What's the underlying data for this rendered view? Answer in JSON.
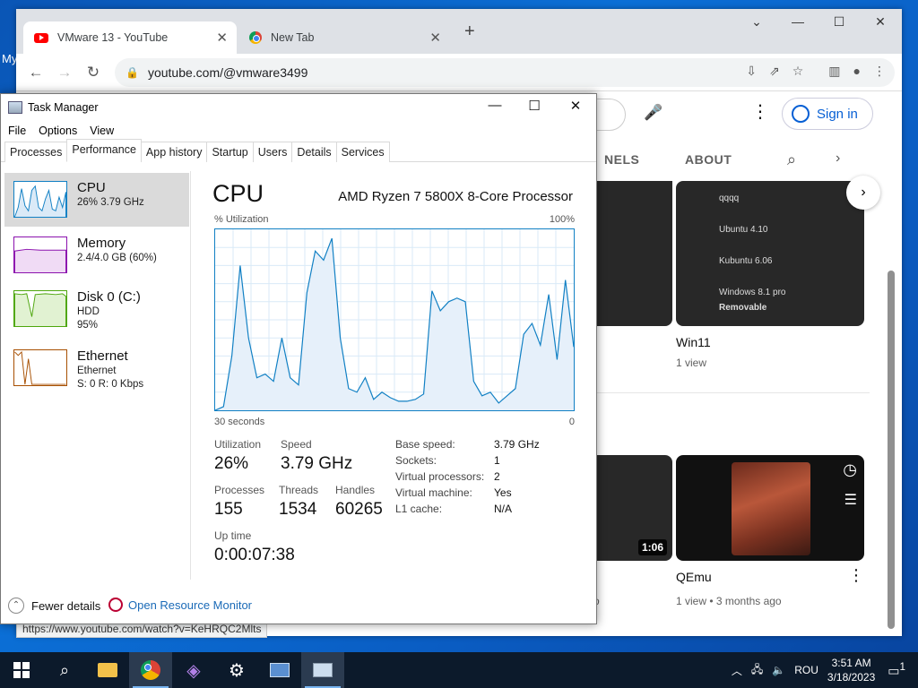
{
  "desktop": {
    "label": "My"
  },
  "browser": {
    "tabs": [
      {
        "label": "VMware 13 - YouTube"
      },
      {
        "label": "New Tab"
      }
    ],
    "url": "youtube.com/@vmware3499",
    "status_url": "https://www.youtube.com/watch?v=KeHRQC2Mlts"
  },
  "youtube": {
    "signin": "Sign in",
    "channel_tabs": [
      "NELS",
      "ABOUT"
    ],
    "videos": [
      {
        "title": "Win11",
        "meta": "1 view"
      },
      {
        "title": "QEmu",
        "meta": "1 view • 3 months ago",
        "duration": "1:06",
        "left_meta_fragment": "o"
      }
    ],
    "thumb_menu_items": [
      "qqqq",
      "Ubuntu 4.10",
      "Kubuntu 6.06",
      "Windows 8.1 pro",
      "Removable"
    ]
  },
  "taskmanager": {
    "title": "Task Manager",
    "menu": [
      "File",
      "Options",
      "View"
    ],
    "tabs": [
      "Processes",
      "Performance",
      "App history",
      "Startup",
      "Users",
      "Details",
      "Services"
    ],
    "sidebar": [
      {
        "name": "CPU",
        "sub1": "26% 3.79 GHz",
        "sub2": "",
        "sub3": "",
        "color": "#1180c4"
      },
      {
        "name": "Memory",
        "sub1": "2.4/4.0 GB (60%)",
        "sub2": "",
        "sub3": "",
        "color": "#8b12ae"
      },
      {
        "name": "Disk 0 (C:)",
        "sub1": "HDD",
        "sub2": "95%",
        "sub3": "",
        "color": "#4da60c"
      },
      {
        "name": "Ethernet",
        "sub1": "Ethernet",
        "sub2": "S: 0 R: 0 Kbps",
        "sub3": "",
        "color": "#a74f01"
      }
    ],
    "cpu": {
      "title": "CPU",
      "model": "AMD Ryzen 7 5800X 8-Core Processor",
      "util_label": "% Utilization",
      "max_label": "100%",
      "time_label": "30 seconds",
      "zero_label": "0",
      "stats": {
        "utilization_label": "Utilization",
        "utilization": "26%",
        "speed_label": "Speed",
        "speed": "3.79 GHz",
        "processes_label": "Processes",
        "processes": "155",
        "threads_label": "Threads",
        "threads": "1534",
        "handles_label": "Handles",
        "handles": "60265",
        "uptime_label": "Up time",
        "uptime": "0:00:07:38"
      },
      "specs": [
        {
          "k": "Base speed:",
          "v": "3.79 GHz"
        },
        {
          "k": "Sockets:",
          "v": "1"
        },
        {
          "k": "Virtual processors:",
          "v": "2"
        },
        {
          "k": "Virtual machine:",
          "v": "Yes"
        },
        {
          "k": "L1 cache:",
          "v": "N/A"
        }
      ],
      "graph_values": [
        0,
        2,
        30,
        80,
        40,
        18,
        20,
        16,
        40,
        18,
        14,
        65,
        88,
        83,
        95,
        40,
        12,
        10,
        18,
        6,
        10,
        7,
        5,
        5,
        6,
        9,
        66,
        55,
        60,
        62,
        60,
        16,
        8,
        10,
        4,
        8,
        12,
        42,
        48,
        36,
        64,
        28,
        72,
        35
      ]
    },
    "footer": {
      "fewer": "Fewer details",
      "resmon": "Open Resource Monitor"
    }
  },
  "taskbar": {
    "lang": "ROU",
    "time": "3:51 AM",
    "date": "3/18/2023",
    "notif": "1"
  }
}
